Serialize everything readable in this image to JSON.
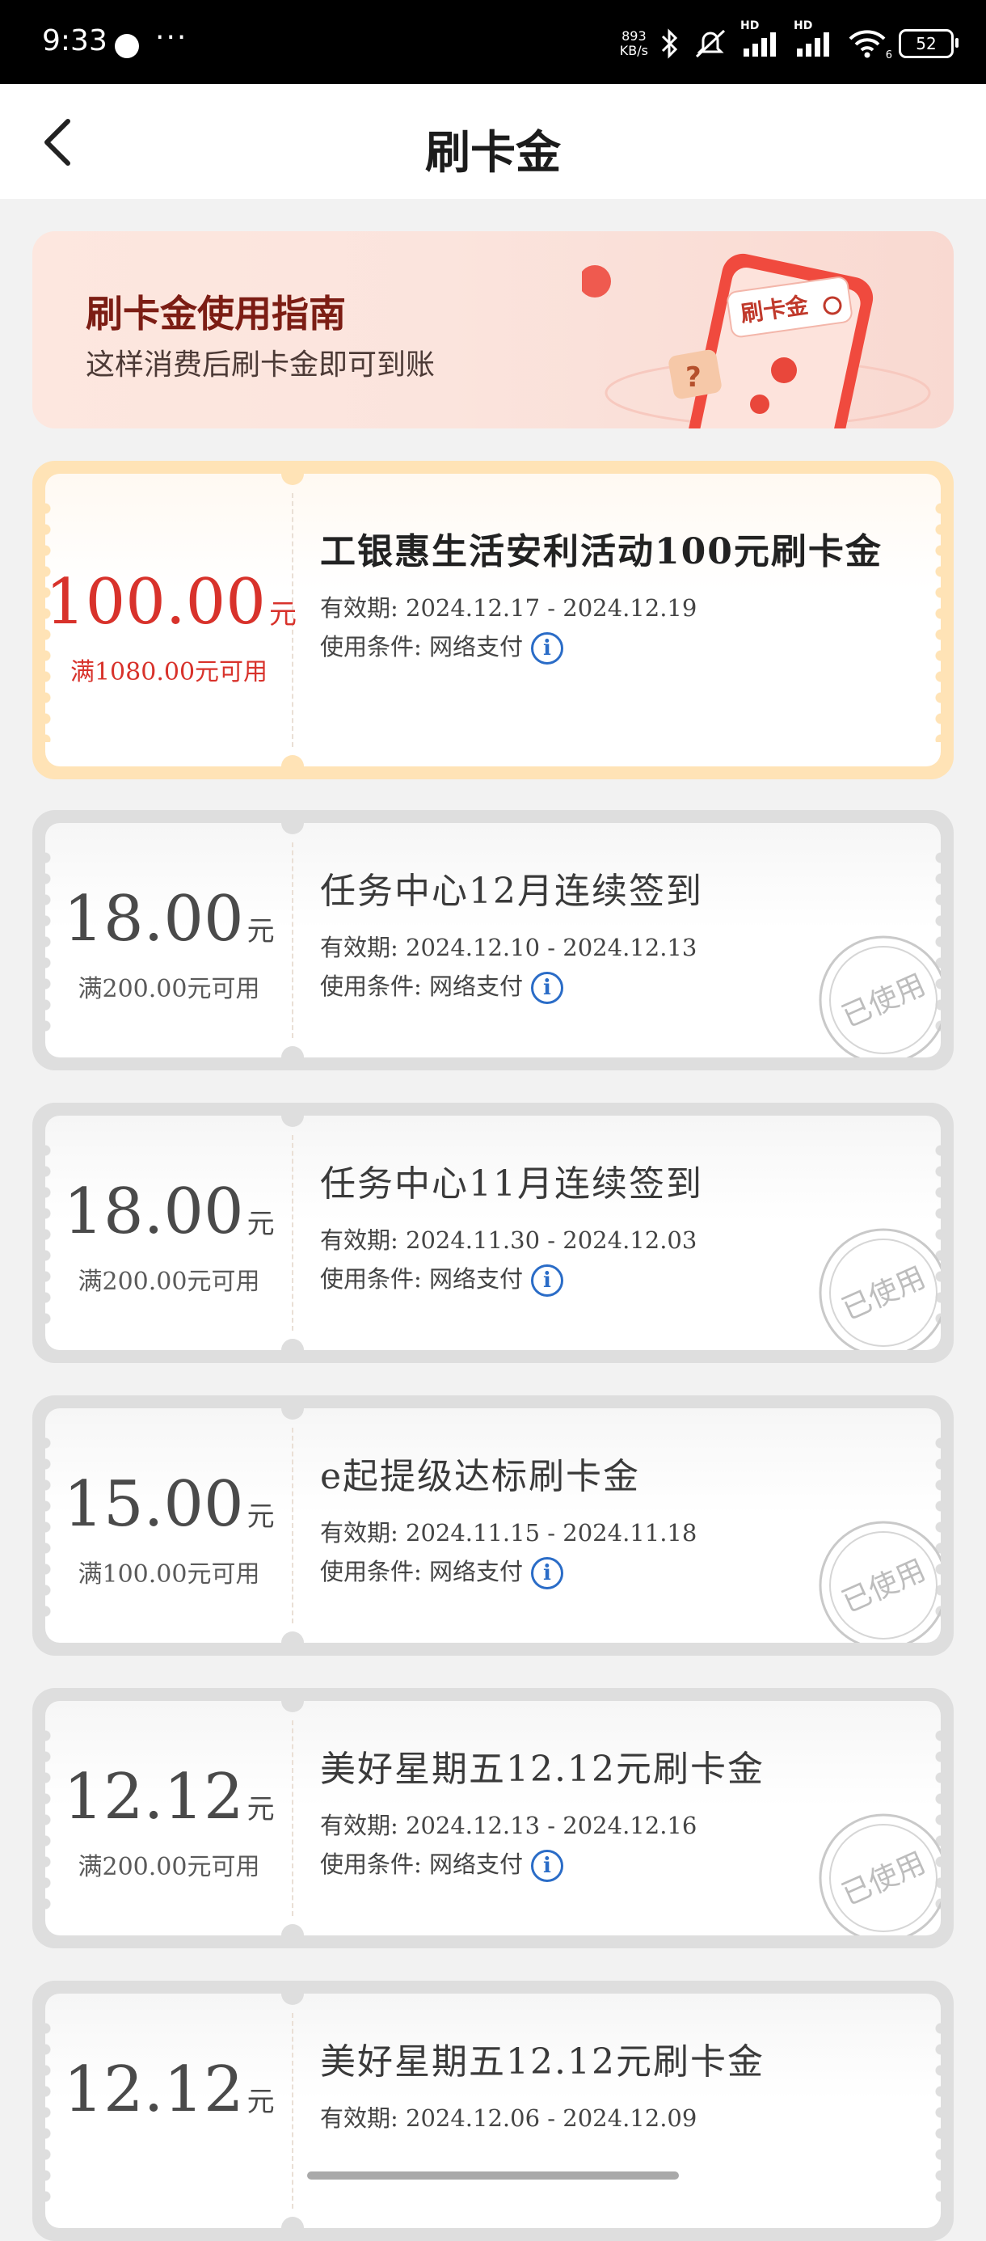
{
  "status_bar": {
    "time": "9:33",
    "net_speed_value": "893",
    "net_speed_unit": "KB/s",
    "hd_label_1": "HD",
    "hd_label_2": "HD",
    "wifi_sub": "6",
    "battery": "52"
  },
  "header": {
    "title": "刷卡金"
  },
  "banner": {
    "title": "刷卡金使用指南",
    "subtitle": "这样消费后刷卡金即可到账",
    "art_label": "刷卡金"
  },
  "coupons": [
    {
      "state": "active",
      "amount": "100.00",
      "unit": "元",
      "condition": "满1080.00元可用",
      "title": "工银惠生活安利活动100元刷卡金",
      "validity": "有效期: 2024.12.17 - 2024.12.19",
      "usage": "使用条件: 网络支付"
    },
    {
      "state": "used",
      "amount": "18.00",
      "unit": "元",
      "condition": "满200.00元可用",
      "title": "任务中心12月连续签到",
      "validity": "有效期: 2024.12.10 - 2024.12.13",
      "usage": "使用条件: 网络支付",
      "stamp": "已使用"
    },
    {
      "state": "used",
      "amount": "18.00",
      "unit": "元",
      "condition": "满200.00元可用",
      "title": "任务中心11月连续签到",
      "validity": "有效期: 2024.11.30 - 2024.12.03",
      "usage": "使用条件: 网络支付",
      "stamp": "已使用"
    },
    {
      "state": "used",
      "amount": "15.00",
      "unit": "元",
      "condition": "满100.00元可用",
      "title": "e起提级达标刷卡金",
      "validity": "有效期: 2024.11.15 - 2024.11.18",
      "usage": "使用条件: 网络支付",
      "stamp": "已使用"
    },
    {
      "state": "used",
      "amount": "12.12",
      "unit": "元",
      "condition": "满200.00元可用",
      "title": "美好星期五12.12元刷卡金",
      "validity": "有效期: 2024.12.13 - 2024.12.16",
      "usage": "使用条件: 网络支付",
      "stamp": "已使用"
    },
    {
      "state": "used",
      "amount": "12.12",
      "unit": "元",
      "condition": "",
      "title": "美好星期五12.12元刷卡金",
      "validity": "有效期: 2024.12.06 - 2024.12.09",
      "usage": "",
      "stamp": ""
    }
  ],
  "colors": {
    "accent_red": "#d8322b",
    "active_border": "#ffe3b6",
    "used_border": "#dedede",
    "info_blue": "#2a6cc7"
  },
  "icons": {
    "back": "chevron-left-icon",
    "info": "info-icon",
    "stamp": "used-stamp-icon"
  }
}
